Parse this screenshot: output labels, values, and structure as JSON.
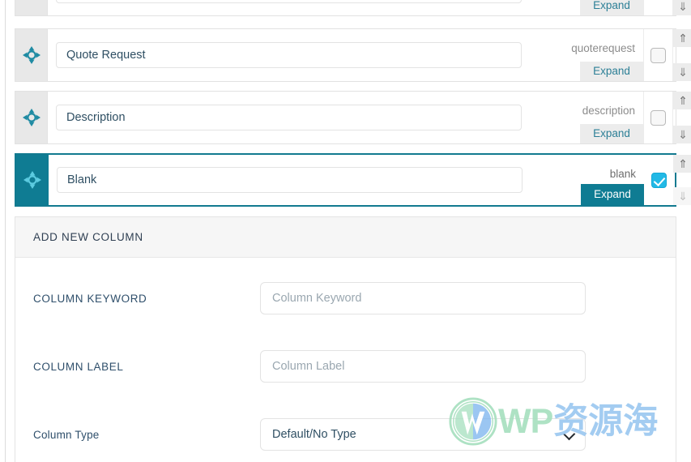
{
  "columns_list": {
    "rows": [
      {
        "id": "partial-top",
        "title": "",
        "keyword": "",
        "expand_label": "Expand",
        "checked": false,
        "active": false,
        "move_icon": "move-arrows-icon",
        "up_icon": "⇑",
        "down_icon": "⇓"
      },
      {
        "id": "quoterequest",
        "title": "Quote Request",
        "keyword": "quoterequest",
        "expand_label": "Expand",
        "checked": false,
        "active": false,
        "move_icon": "move-arrows-icon",
        "up_icon": "⇑",
        "down_icon": "⇓"
      },
      {
        "id": "description",
        "title": "Description",
        "keyword": "description",
        "expand_label": "Expand",
        "checked": false,
        "active": false,
        "move_icon": "move-arrows-icon",
        "up_icon": "⇑",
        "down_icon": "⇓"
      },
      {
        "id": "blank",
        "title": "Blank",
        "keyword": "blank",
        "expand_label": "Expand",
        "checked": true,
        "active": true,
        "move_icon": "move-arrows-icon",
        "up_icon": "⇑",
        "down_icon": "⇓"
      }
    ]
  },
  "add_new_column": {
    "header": "ADD NEW COLUMN",
    "fields": [
      {
        "label": "COLUMN KEYWORD",
        "placeholder": "Column Keyword",
        "value": "",
        "type": "text"
      },
      {
        "label": "COLUMN LABEL",
        "placeholder": "Column Label",
        "value": "",
        "type": "text"
      },
      {
        "label": "Column Type",
        "selected": "Default/No Type",
        "type": "select"
      }
    ]
  },
  "watermark": {
    "text_en": "WP",
    "text_cn": "资源海",
    "logo": "wordpress-logo-icon",
    "color_en": "#a8e0c0",
    "color_cn": "#9cc8f0"
  },
  "theme": {
    "accent_teal": "#0f7c93",
    "link_teal": "#2c7f96",
    "checkbox_blue": "#22b9e6",
    "label_navy": "#2f4f6b",
    "handle_gray": "#e8e8e8"
  }
}
